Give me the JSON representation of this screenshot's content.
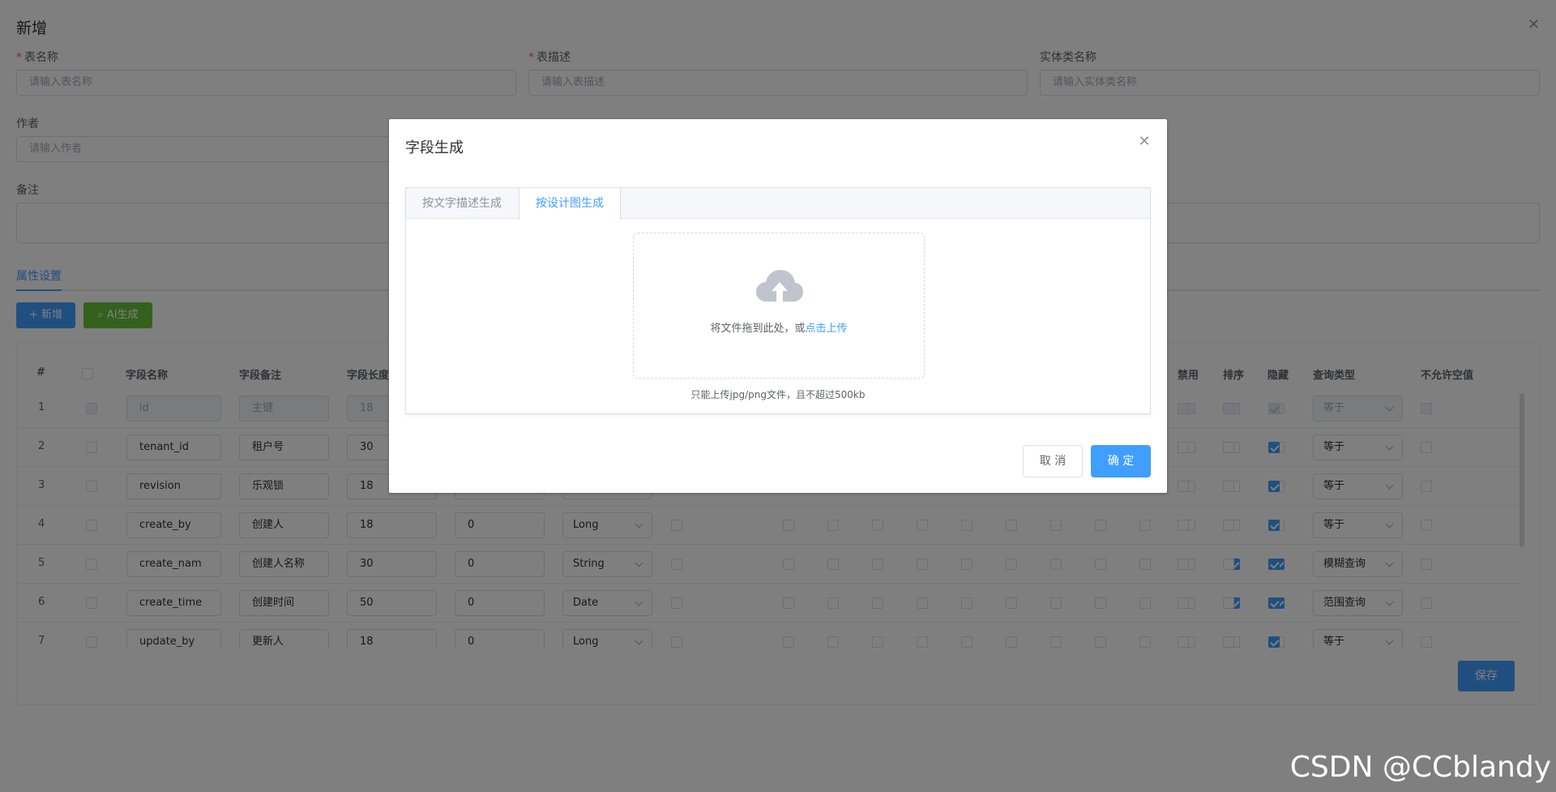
{
  "form": {
    "title": "新增",
    "table_name_label": "表名称",
    "table_name_placeholder": "请输入表名称",
    "table_desc_label": "表描述",
    "table_desc_placeholder": "请输入表描述",
    "entity_label": "实体类名称",
    "entity_placeholder": "请输入实体类名称",
    "author_label": "作者",
    "author_placeholder": "请输入作者",
    "remark_label": "备注",
    "tab_label": "属性设置",
    "add_button": "+ 新增",
    "ai_button": "AI生成",
    "save_button": "保存"
  },
  "table": {
    "headers": [
      "#",
      "字段名称",
      "字段备注",
      "字段长度",
      "禁用",
      "排序",
      "隐藏",
      "查询类型",
      "不允许空值"
    ],
    "rows": [
      {
        "num": "1",
        "name": "id",
        "comment": "主键",
        "length": "18",
        "scale": "",
        "type": "",
        "query": "等于",
        "disabled": true
      },
      {
        "num": "2",
        "name": "tenant_id",
        "comment": "租户号",
        "length": "30",
        "scale": "",
        "type": "",
        "query": "等于"
      },
      {
        "num": "3",
        "name": "revision",
        "comment": "乐观锁",
        "length": "18",
        "scale": "",
        "type": "",
        "query": "等于"
      },
      {
        "num": "4",
        "name": "create_by",
        "comment": "创建人",
        "length": "18",
        "scale": "0",
        "type": "Long",
        "query": "等于"
      },
      {
        "num": "5",
        "name": "create_nam",
        "comment": "创建人名称",
        "length": "30",
        "scale": "0",
        "type": "String",
        "query": "模糊查询"
      },
      {
        "num": "6",
        "name": "create_time",
        "comment": "创建时间",
        "length": "50",
        "scale": "0",
        "type": "Date",
        "query": "范围查询"
      },
      {
        "num": "7",
        "name": "update_by",
        "comment": "更新人",
        "length": "18",
        "scale": "0",
        "type": "Long",
        "query": "等于"
      }
    ]
  },
  "dialog": {
    "title": "字段生成",
    "tab_text": "按文字描述生成",
    "tab_image": "按设计图生成",
    "upload_text": "将文件拖到此处，或",
    "upload_link": "点击上传",
    "upload_tip": "只能上传jpg/png文件，且不超过500kb",
    "cancel": "取 消",
    "ok": "确 定"
  },
  "watermark": "CSDN @CCblandy",
  "colors": {
    "primary": "#409eff",
    "success": "#67c23a",
    "danger": "#f56c6c",
    "overlay": "rgba(0,0,0,0.5)"
  },
  "icons": [
    "close-icon",
    "upload-cloud-icon",
    "plus-icon",
    "search-icon"
  ]
}
